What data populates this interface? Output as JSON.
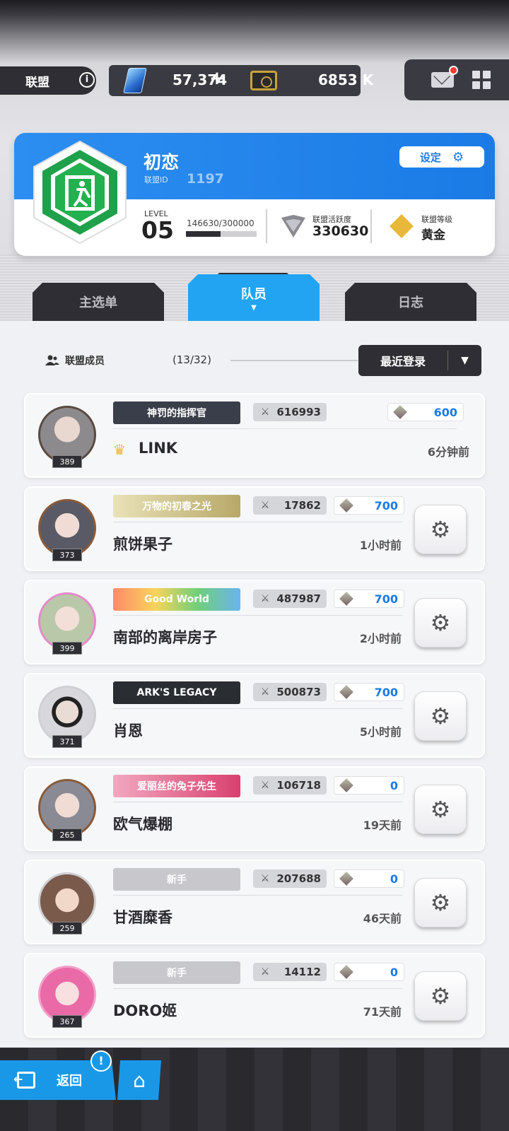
{
  "topbar": {
    "alliance_label": "联盟",
    "info_icon": "i",
    "gems": "57,374",
    "gems_plus": "+",
    "credits": "6853 K"
  },
  "card": {
    "name": "初恋",
    "id_label": "联盟ID",
    "id": "1197",
    "settings_label": "设定",
    "level_label": "LEVEL",
    "level": "05",
    "exp_text": "146630/300000",
    "exp_progress": 0.489,
    "activity_label": "联盟活跃度",
    "activity_value": "330630",
    "rank_label": "联盟等级",
    "rank_value": "黄金"
  },
  "tabs": [
    {
      "label": "主选单"
    },
    {
      "label": "队员"
    },
    {
      "label": "日志"
    }
  ],
  "members_header": {
    "label": "联盟成员",
    "count": "(13/32)",
    "sort_label": "最近登录"
  },
  "members": [
    {
      "level": "389",
      "title": "神罚的指挥官",
      "power": "616993",
      "contrib": "600",
      "name": "LINK",
      "time": "6分钟前",
      "title_bg": "#3a3e4a"
    },
    {
      "level": "373",
      "title": "万物的初春之光",
      "power": "17862",
      "contrib": "700",
      "name": "煎饼果子",
      "time": "1小时前",
      "title_bg": "#c9b77a"
    },
    {
      "level": "399",
      "title": "Good World",
      "power": "487987",
      "contrib": "700",
      "name": "南部的离岸房子",
      "time": "2小时前",
      "title_bg": "#6fbf6a"
    },
    {
      "level": "371",
      "title": "ARK'S LEGACY",
      "power": "500873",
      "contrib": "700",
      "name": "肖恩",
      "time": "5小时前",
      "title_bg": "#2a2e32"
    },
    {
      "level": "265",
      "title": "爱丽丝的兔子先生",
      "power": "106718",
      "contrib": "0",
      "name": "欧气爆棚",
      "time": "19天前",
      "title_bg": "#d8537a"
    },
    {
      "level": "259",
      "title": "新手",
      "power": "207688",
      "contrib": "0",
      "name": "甘酒糜香",
      "time": "46天前",
      "title_bg": ""
    },
    {
      "level": "367",
      "title": "新手",
      "power": "14112",
      "contrib": "0",
      "name": "DORO姬",
      "time": "71天前",
      "title_bg": ""
    }
  ],
  "bottom": {
    "back_label": "返回",
    "alert": "!"
  }
}
